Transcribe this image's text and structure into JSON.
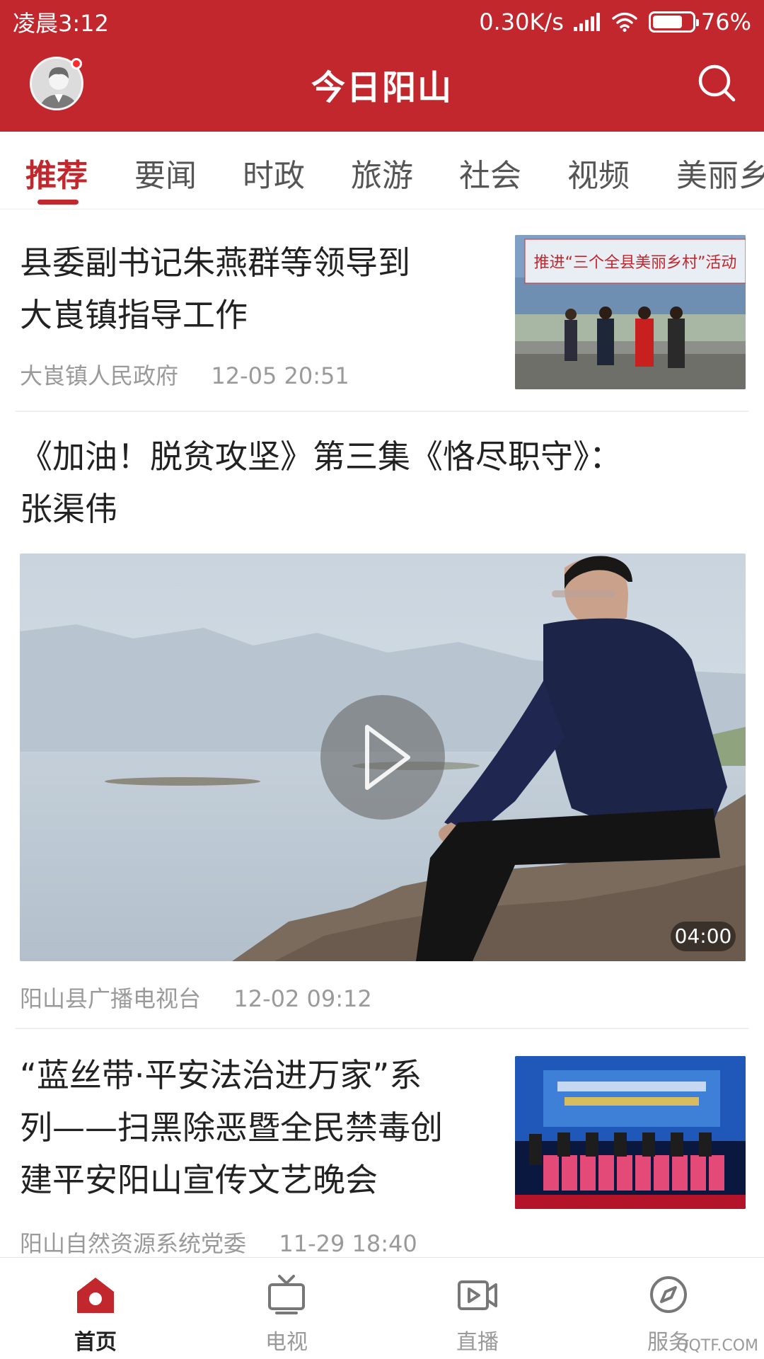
{
  "status_bar": {
    "time": "凌晨3:12",
    "network_speed": "0.30K/s",
    "battery_level": 0.76,
    "battery_text": "76%"
  },
  "header": {
    "title": "今日阳山",
    "avatar_icon": "user-avatar",
    "search_icon": "search-icon",
    "accent_color": "#c1272d"
  },
  "tabs": [
    {
      "label": "推荐",
      "active": true
    },
    {
      "label": "要闻"
    },
    {
      "label": "时政"
    },
    {
      "label": "旅游"
    },
    {
      "label": "社会"
    },
    {
      "label": "视频"
    },
    {
      "label": "美丽乡"
    }
  ],
  "feed": {
    "items": [
      {
        "title_line1": "县委副书记朱燕群等领导到",
        "title_line2": "大崀镇指导工作",
        "source": "大崀镇人民政府",
        "time": "12-05 20:51",
        "banner_text": "推进“三个全县美丽乡村”活动"
      },
      {
        "title_line1": "《加油！脱贫攻坚》第三集《恪尽职守》：",
        "title_line2": "张渠伟",
        "source": "阳山县广播电视台",
        "time": "12-02 09:12",
        "duration": "04:00"
      },
      {
        "title_line1": "“蓝丝带·平安法治进万家”系",
        "title_line2": "列——扫黑除恶暨全民禁毒创",
        "title_line3": "建平安阳山宣传文艺晚会",
        "source": "阳山自然资源系统党委",
        "time": "11-29 18:40"
      }
    ]
  },
  "bottom_nav": [
    {
      "label": "首页",
      "icon": "home-icon",
      "active": true
    },
    {
      "label": "电视",
      "icon": "tv-icon"
    },
    {
      "label": "直播",
      "icon": "live-video-icon"
    },
    {
      "label": "服务",
      "icon": "compass-icon"
    }
  ],
  "watermark": "QQTF.COM"
}
